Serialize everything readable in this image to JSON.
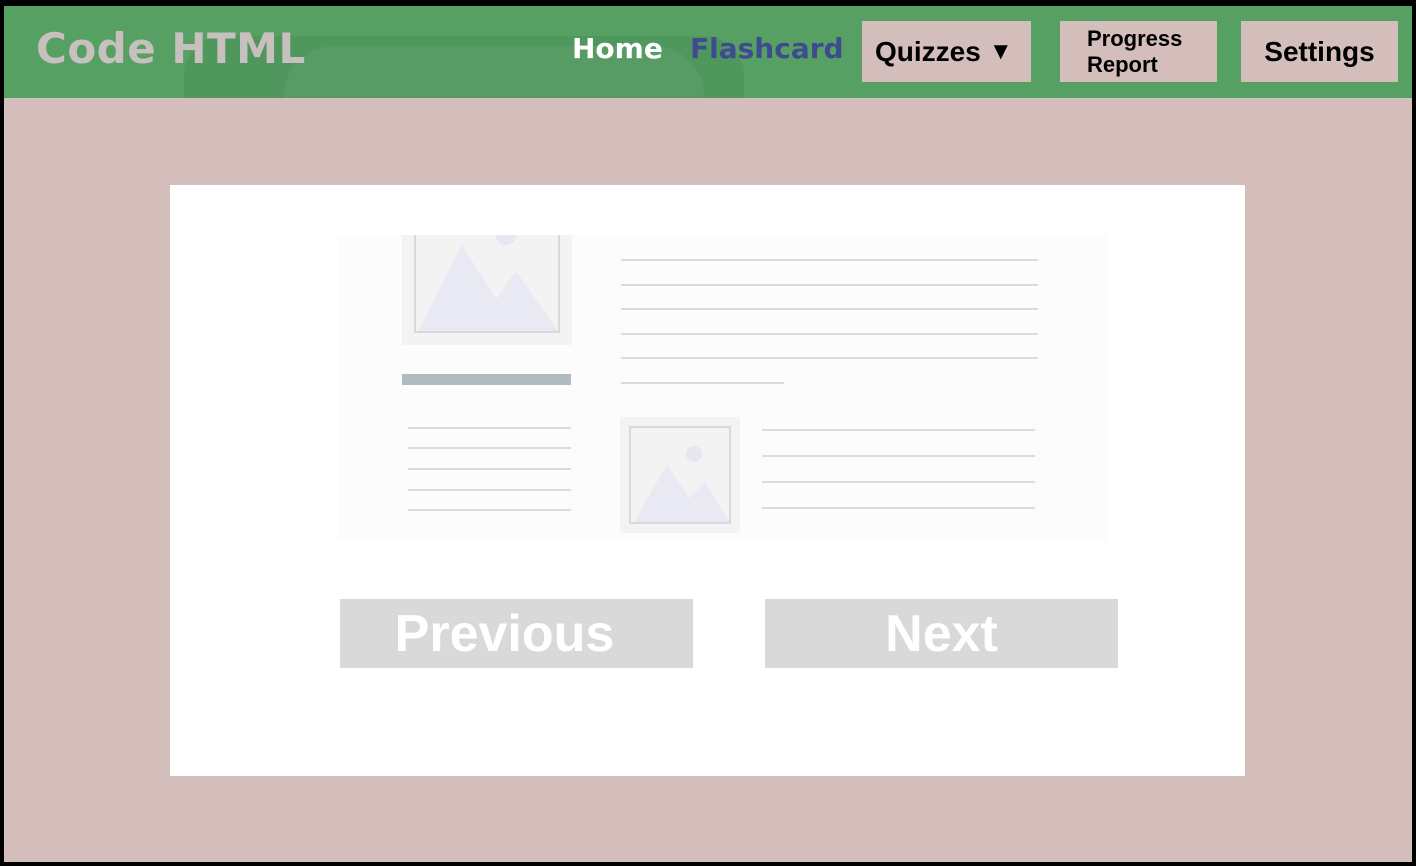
{
  "navbar": {
    "brand": "Code HTML",
    "links": {
      "home": "Home",
      "flashcard": "Flashcard"
    },
    "quizzes_label": "Quizzes",
    "quizzes_caret": "▼",
    "progress_label_line1": "Progress",
    "progress_label_line2": "Report",
    "settings_label": "Settings"
  },
  "flashcard": {
    "illustration_icon": "document-placeholder-illustration",
    "previous_label": "Previous",
    "next_label": "Next"
  },
  "colors": {
    "navbar_bg": "#55a062",
    "page_bg": "#d3bebc",
    "card_bg": "#ffffff",
    "active_link": "#3f4b91",
    "button_gray": "#d9d9d9"
  }
}
